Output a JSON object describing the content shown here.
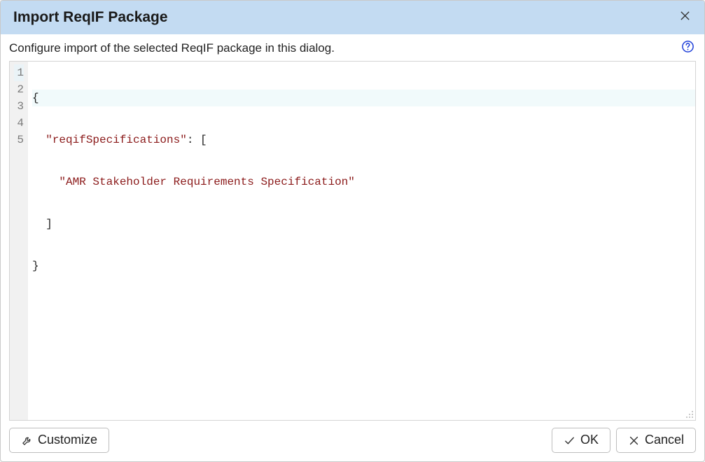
{
  "dialog": {
    "title": "Import ReqIF Package",
    "description": "Configure import of the selected ReqIF package in this dialog."
  },
  "editor": {
    "lineNumbers": [
      "1",
      "2",
      "3",
      "4",
      "5"
    ],
    "activeLine": 1,
    "tokens": {
      "l1": "{",
      "l2_indent": "  ",
      "l2_key": "\"reqifSpecifications\"",
      "l2_after": ": [",
      "l3_indent": "    ",
      "l3_str": "\"AMR Stakeholder Requirements Specification\"",
      "l4": "  ]",
      "l5": "}"
    }
  },
  "buttons": {
    "customize": "Customize",
    "ok": "OK",
    "cancel": "Cancel"
  },
  "icons": {
    "close": "close-icon",
    "help": "help-icon",
    "wrench": "wrench-icon",
    "check": "check-icon",
    "x": "x-icon",
    "resize": "resize-grip-icon"
  }
}
